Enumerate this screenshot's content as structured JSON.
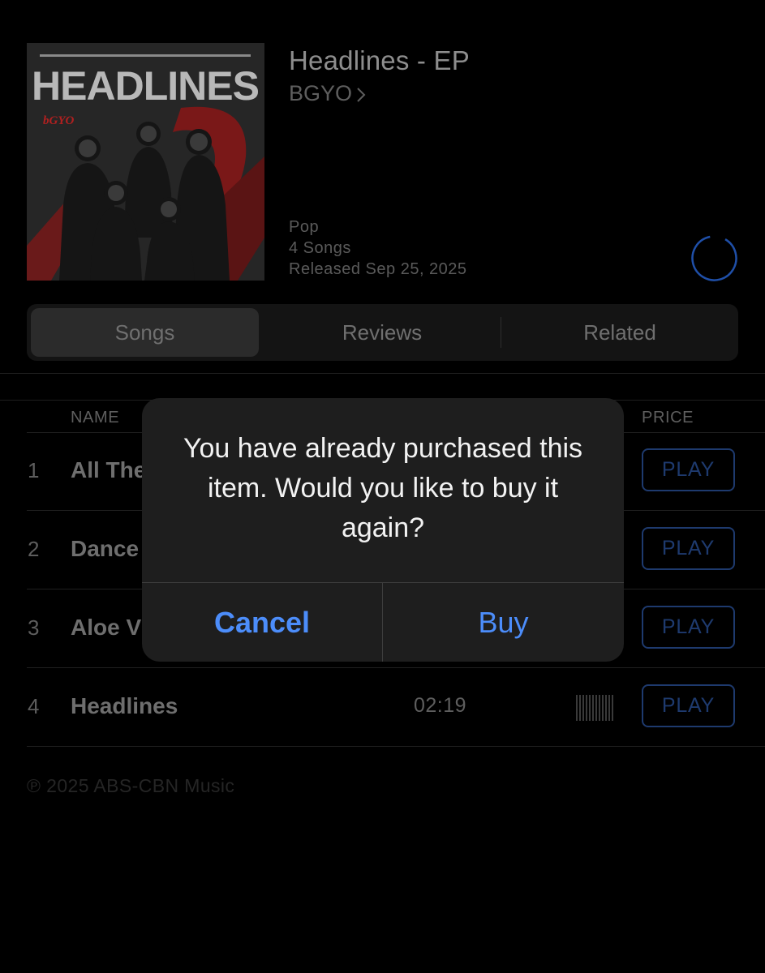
{
  "album": {
    "cover_text": "HEADLINES",
    "cover_logo": "bGYO",
    "title": "Headlines - EP",
    "artist": "BGYO",
    "genre": "Pop",
    "song_count": "4 Songs",
    "released": "Released Sep 25, 2025"
  },
  "tabs": [
    {
      "label": "Songs",
      "active": true
    },
    {
      "label": "Reviews",
      "active": false
    },
    {
      "label": "Related",
      "active": false
    }
  ],
  "columns": {
    "name": "NAME",
    "price": "PRICE"
  },
  "songs": [
    {
      "number": "1",
      "title": "All The",
      "duration": "",
      "action": "PLAY"
    },
    {
      "number": "2",
      "title": "Dance",
      "duration": "",
      "action": "PLAY"
    },
    {
      "number": "3",
      "title": "Aloe V",
      "duration": "",
      "action": "PLAY"
    },
    {
      "number": "4",
      "title": "Headlines",
      "duration": "02:19",
      "action": "PLAY"
    }
  ],
  "copyright": "℗ 2025 ABS-CBN Music",
  "alert": {
    "message": "You have already purchased this item. Would you like to buy it again?",
    "cancel_label": "Cancel",
    "buy_label": "Buy"
  },
  "colors": {
    "accent": "#4c8dfa",
    "dimmed_accent": "#1e3a6e",
    "background": "#000000",
    "alert_background": "#1e1e1e"
  },
  "icons": [
    "chevron-right-icon",
    "download-progress-icon",
    "popularity-bars-icon"
  ]
}
